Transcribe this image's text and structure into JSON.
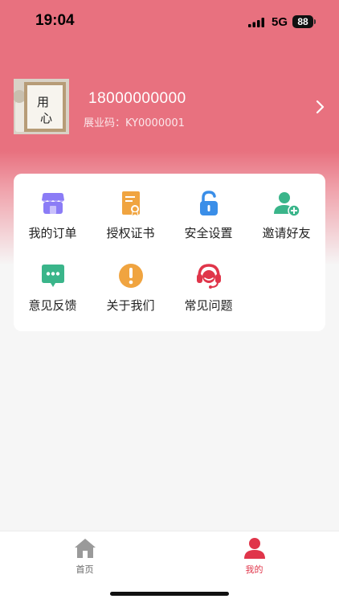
{
  "status_bar": {
    "time": "19:04",
    "network": "5G",
    "battery": "88"
  },
  "profile": {
    "phone": "18000000000",
    "code_label": "展业码：KY0000001",
    "avatar_text_1": "用",
    "avatar_text_2": "心"
  },
  "menu": {
    "items": [
      {
        "label": "我的订单",
        "icon": "store-icon",
        "color": "#8b7cf6"
      },
      {
        "label": "授权证书",
        "icon": "certificate-icon",
        "color": "#f0a440"
      },
      {
        "label": "安全设置",
        "icon": "unlock-icon",
        "color": "#3a8ee8"
      },
      {
        "label": "邀请好友",
        "icon": "add-user-icon",
        "color": "#3ab58a"
      },
      {
        "label": "意见反馈",
        "icon": "chat-bubble-icon",
        "color": "#3ab58a"
      },
      {
        "label": "关于我们",
        "icon": "exclamation-icon",
        "color": "#f0a440"
      },
      {
        "label": "常见问题",
        "icon": "headset-icon",
        "color": "#e0354a"
      }
    ]
  },
  "tabbar": {
    "home_label": "首页",
    "mine_label": "我的",
    "inactive_color": "#9a9a9a",
    "active_color": "#e0354a"
  },
  "colors": {
    "hero": "#e8717f"
  }
}
